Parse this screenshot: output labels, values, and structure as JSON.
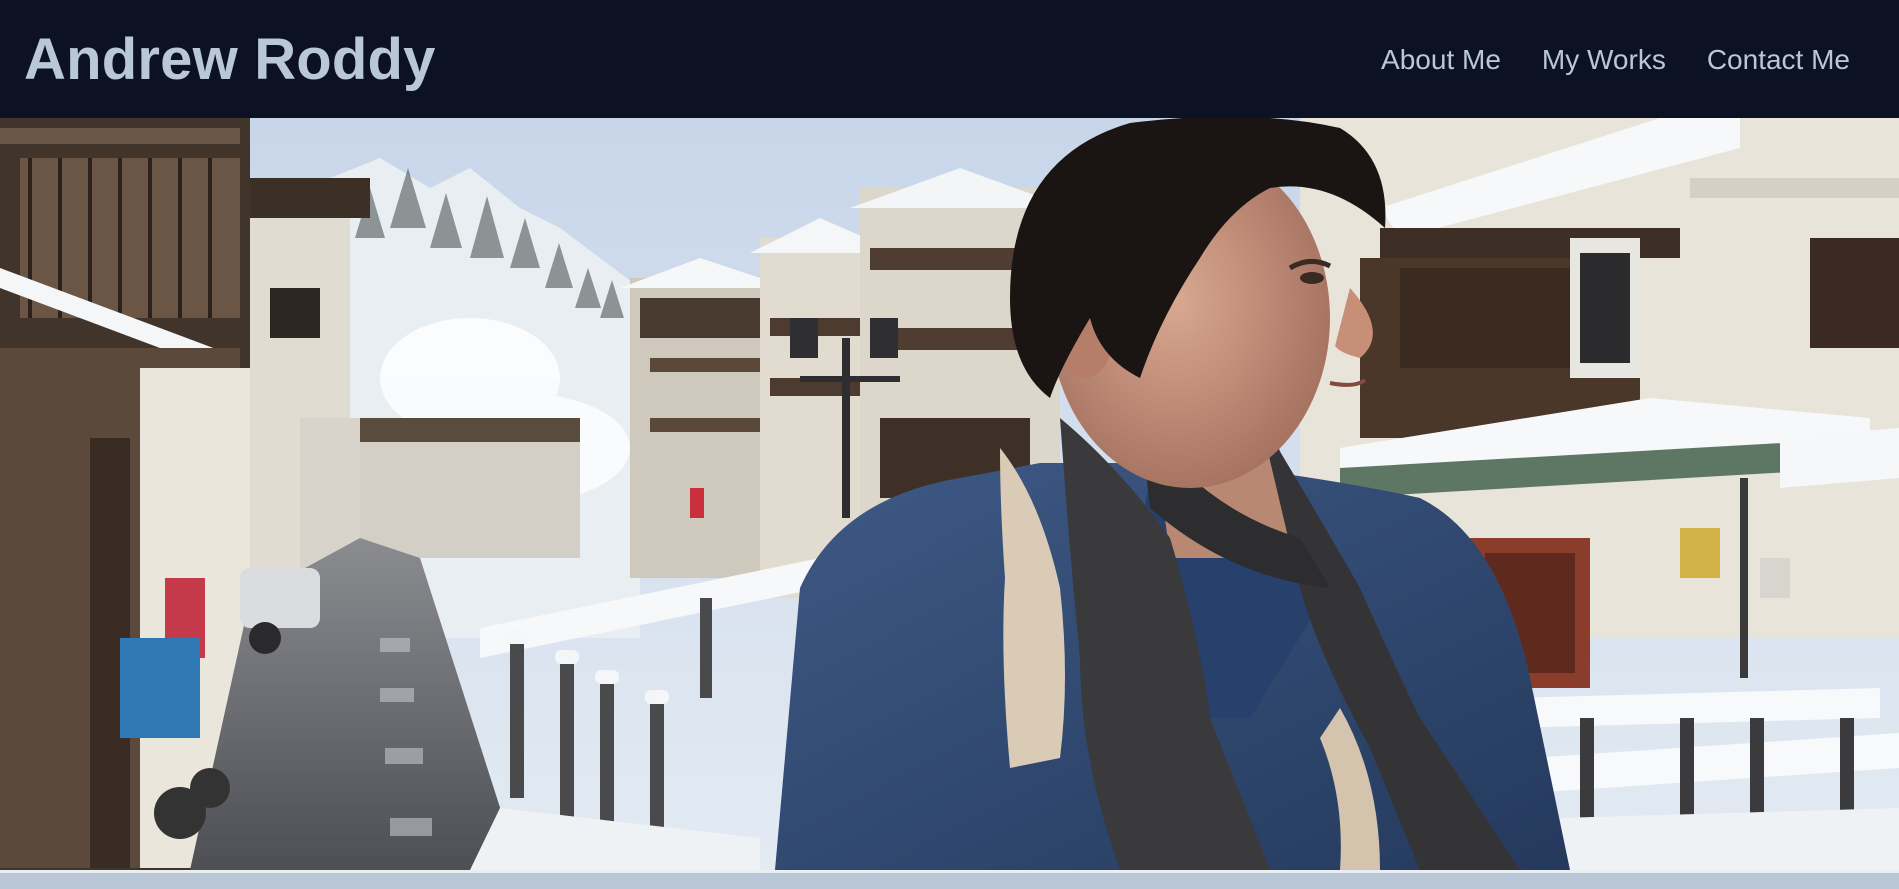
{
  "header": {
    "site_title": "Andrew Roddy",
    "nav": [
      {
        "label": "About Me"
      },
      {
        "label": "My Works"
      },
      {
        "label": "Contact Me"
      }
    ]
  },
  "hero": {
    "image_alt": "Andrew Roddy in a snowy onsen town street"
  },
  "colors": {
    "header_bg": "#0c1124",
    "header_text": "#b9c7d6",
    "page_band": "#b9c7d6"
  }
}
